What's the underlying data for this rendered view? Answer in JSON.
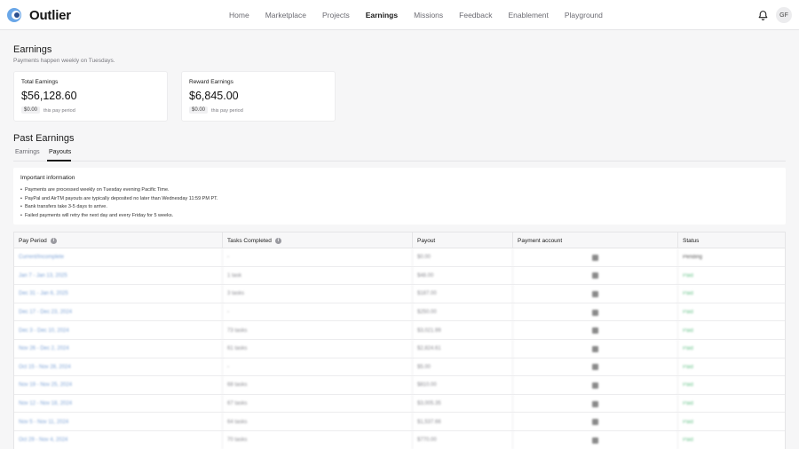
{
  "app": {
    "name": "Outlier"
  },
  "nav": {
    "items": [
      "Home",
      "Marketplace",
      "Projects",
      "Earnings",
      "Missions",
      "Feedback",
      "Enablement",
      "Playground"
    ],
    "active": "Earnings"
  },
  "user": {
    "initials": "GF"
  },
  "earnings": {
    "title": "Earnings",
    "subtitle": "Payments happen weekly on Tuesdays.",
    "cards": [
      {
        "label": "Total Earnings",
        "amount": "$56,128.60",
        "period_amount": "$0.00",
        "period_label": "this pay period"
      },
      {
        "label": "Reward Earnings",
        "amount": "$6,845.00",
        "period_amount": "$0.00",
        "period_label": "this pay period"
      }
    ]
  },
  "past_earnings": {
    "title": "Past Earnings",
    "tabs": [
      "Earnings",
      "Payouts"
    ],
    "active_tab": "Payouts"
  },
  "important_info": {
    "title": "Important information",
    "items": [
      "Payments are processed weekly on Tuesday evening Pacific Time.",
      "PayPal and AirTM payouts are typically deposited no later than Wednesday 11:59 PM PT.",
      "Bank transfers take 3-5 days to arrive.",
      "Failed payments will retry the next day and every Friday for 5 weeks."
    ]
  },
  "table": {
    "columns": [
      "Pay Period",
      "Tasks Completed",
      "Payout",
      "Payment account",
      "Status"
    ],
    "rows": [
      [
        "Current/Incomplete",
        "-",
        "$0.00",
        "",
        "Pending"
      ],
      [
        "Jan 7 - Jan 13, 2025",
        "1 task",
        "$48.00",
        "",
        "Paid"
      ],
      [
        "Dec 31 - Jan 6, 2025",
        "3 tasks",
        "$187.00",
        "",
        "Paid"
      ],
      [
        "Dec 17 - Dec 23, 2024",
        "-",
        "$250.00",
        "",
        "Paid"
      ],
      [
        "Dec 3 - Dec 10, 2024",
        "73 tasks",
        "$3,021.99",
        "",
        "Paid"
      ],
      [
        "Nov 26 - Dec 2, 2024",
        "61 tasks",
        "$2,824.61",
        "",
        "Paid"
      ],
      [
        "Oct 15 - Nov 28, 2024",
        "-",
        "$5.00",
        "",
        "Paid"
      ],
      [
        "Nov 19 - Nov 25, 2024",
        "68 tasks",
        "$810.00",
        "",
        "Paid"
      ],
      [
        "Nov 12 - Nov 18, 2024",
        "67 tasks",
        "$3,005.35",
        "",
        "Paid"
      ],
      [
        "Nov 5 - Nov 11, 2024",
        "64 tasks",
        "$1,537.66",
        "",
        "Paid"
      ],
      [
        "Oct 29 - Nov 4, 2024",
        "70 tasks",
        "$770.00",
        "",
        "Paid"
      ]
    ]
  }
}
